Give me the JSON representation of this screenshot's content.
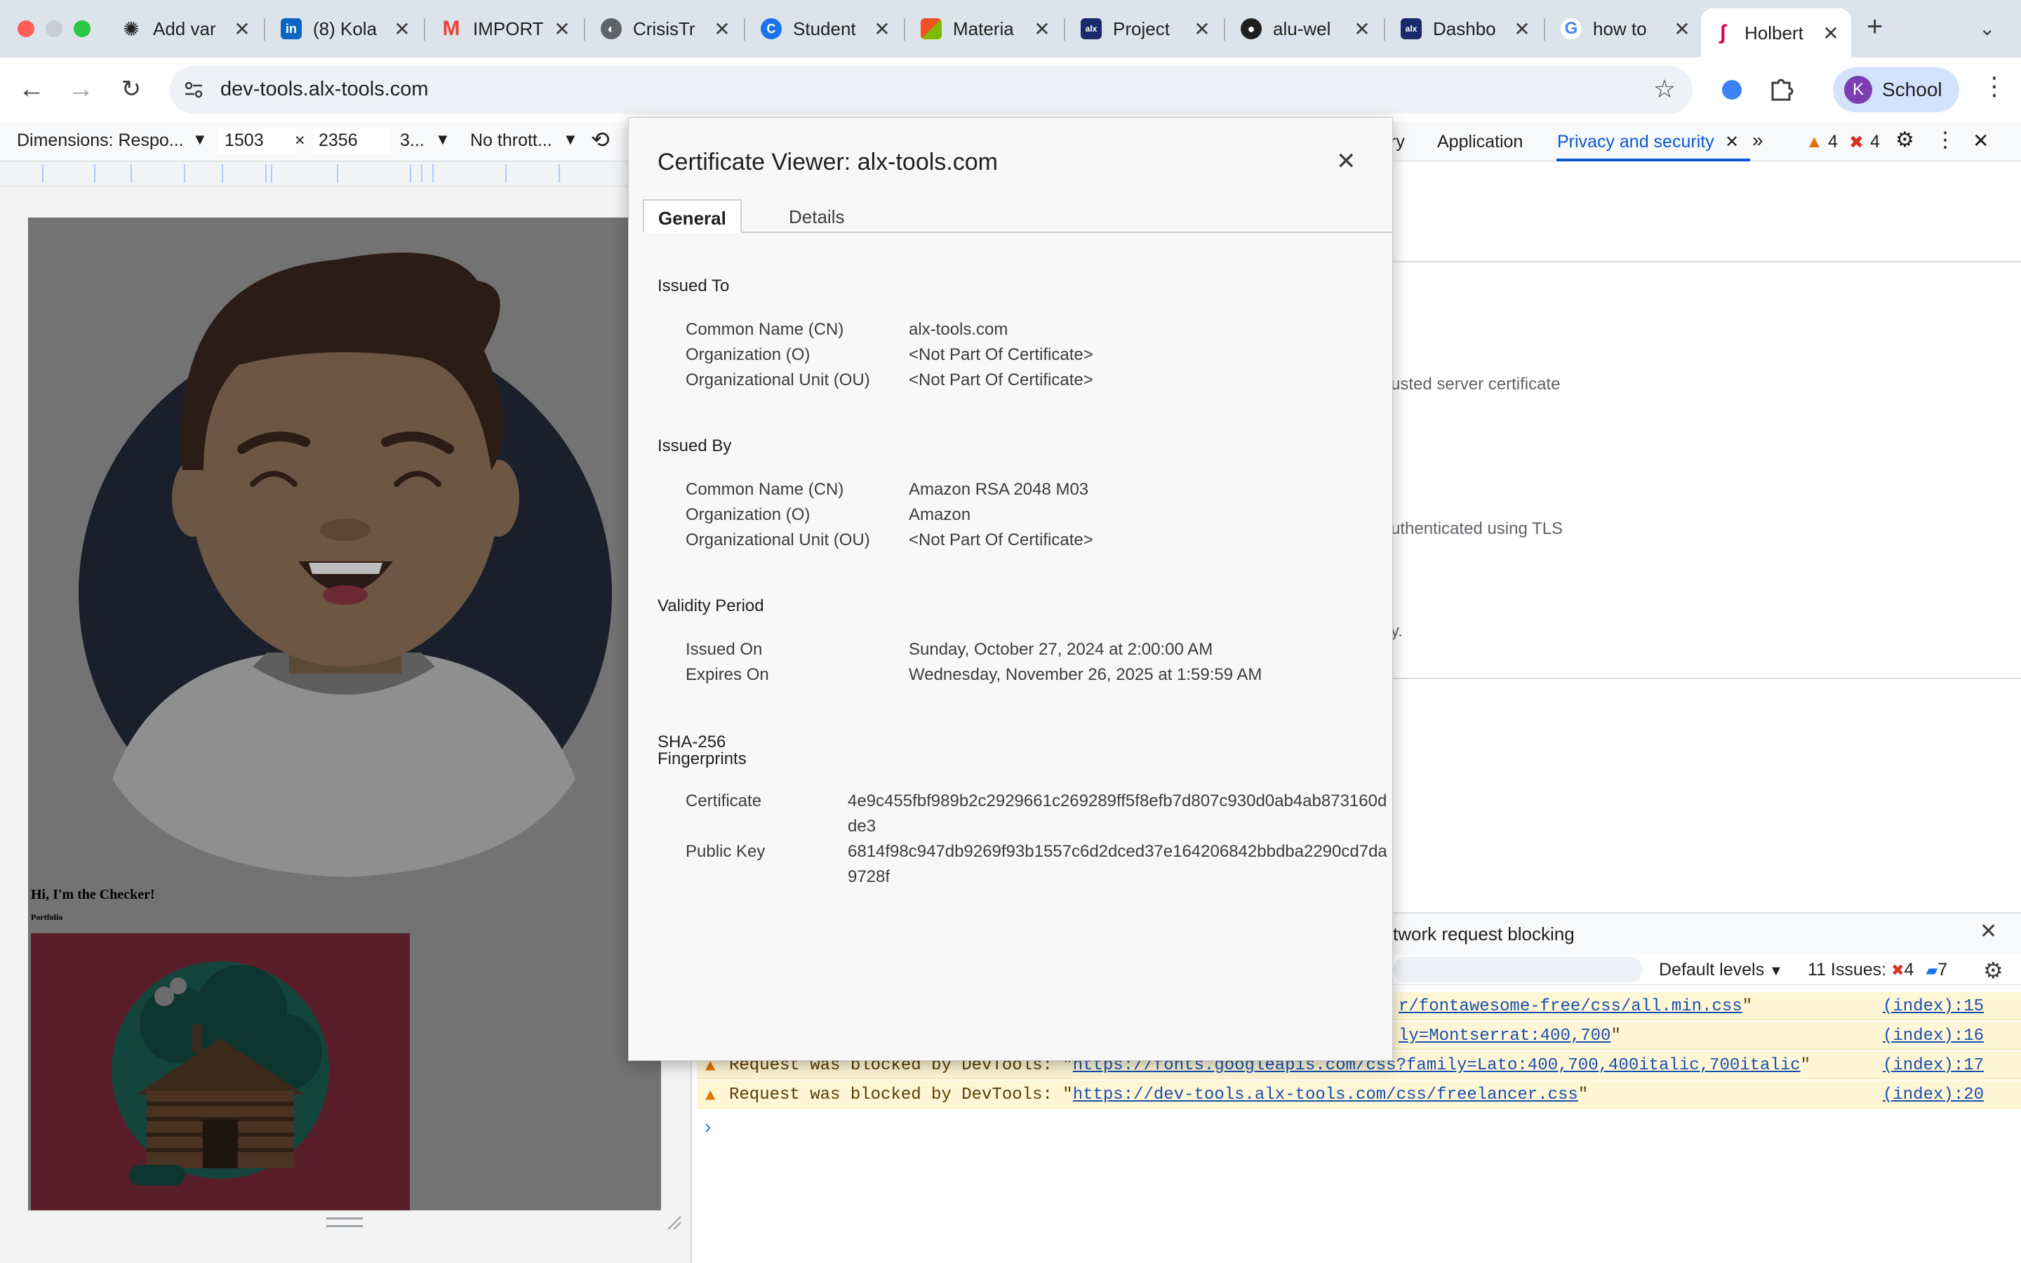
{
  "tabs": [
    {
      "title": "Add var",
      "icon": "openai-icon",
      "color": "#1f1f1f"
    },
    {
      "title": "(8) Kola",
      "icon": "linkedin-icon",
      "color": "#0a66c2"
    },
    {
      "title": "IMPORT",
      "icon": "gmail-icon",
      "color": "#ea4335"
    },
    {
      "title": "CrisisTr",
      "icon": "globe-icon",
      "color": "#5f6368"
    },
    {
      "title": "Student",
      "icon": "c-letter-icon",
      "color": "#1a73e8"
    },
    {
      "title": "Materia",
      "icon": "microsoft-icon",
      "color": "#f25022"
    },
    {
      "title": "Project",
      "icon": "alx-icon",
      "color": "#1b2a6b"
    },
    {
      "title": "alu-wel",
      "icon": "github-icon",
      "color": "#1f1f1f"
    },
    {
      "title": "Dashbo",
      "icon": "alx-icon",
      "color": "#1b2a6b"
    },
    {
      "title": "how to",
      "icon": "google-icon",
      "color": "#4285f4"
    },
    {
      "title": "Holbert",
      "icon": "holberton-icon",
      "color": "#e0004d"
    }
  ],
  "address": {
    "url": "dev-tools.alx-tools.com"
  },
  "profile": {
    "initial": "K",
    "name": "School"
  },
  "device_toolbar": {
    "dimensions": "Dimensions: Respo...",
    "width": "1503",
    "times": "×",
    "height": "2356",
    "dpr": "3...",
    "throttle": "No thrott..."
  },
  "devtools": {
    "tabs": [
      "ry",
      "Application",
      "Privacy and security"
    ],
    "warning_count": "4",
    "error_count": "4",
    "security_lines": [
      "usted server certificate",
      "uthenticated using TLS",
      "y."
    ],
    "drawer_title": "twork request blocking",
    "default_levels": "Default levels",
    "issues_label": "11 Issues:",
    "issues_errors": "4",
    "issues_info": "7",
    "console_rows": [
      {
        "prefix": "",
        "link": "r/fontawesome-free/css/all.min.css",
        "suffix": "\"",
        "ref": "(index):15"
      },
      {
        "prefix": "",
        "link": "ly=Montserrat:400,700",
        "suffix": "\"",
        "ref": "(index):16"
      },
      {
        "prefix": "Request was blocked by DevTools: \"",
        "link": "https://fonts.googleapis.com/css?family=Lato:400,700,400italic,700italic",
        "suffix": "\"",
        "ref": "(index):17"
      },
      {
        "prefix": "Request was blocked by DevTools: \"",
        "link": "https://dev-tools.alx-tools.com/css/freelancer.css",
        "suffix": "\"",
        "ref": "(index):20"
      }
    ],
    "prompt": "›"
  },
  "page": {
    "greeting": "Hi, I'm the Checker!",
    "portfolio": "Portfolio"
  },
  "certificate": {
    "title": "Certificate Viewer: alx-tools.com",
    "tab_general": "General",
    "tab_details": "Details",
    "issued_to": {
      "heading": "Issued To",
      "cn_label": "Common Name (CN)",
      "cn": "alx-tools.com",
      "o_label": "Organization (O)",
      "o": "<Not Part Of Certificate>",
      "ou_label": "Organizational Unit (OU)",
      "ou": "<Not Part Of Certificate>"
    },
    "issued_by": {
      "heading": "Issued By",
      "cn_label": "Common Name (CN)",
      "cn": "Amazon RSA 2048 M03",
      "o_label": "Organization (O)",
      "o": "Amazon",
      "ou_label": "Organizational Unit (OU)",
      "ou": "<Not Part Of Certificate>"
    },
    "validity": {
      "heading": "Validity Period",
      "issued_label": "Issued On",
      "issued": "Sunday, October 27, 2024 at 2:00:00 AM",
      "expires_label": "Expires On",
      "expires": "Wednesday, November 26, 2025 at 1:59:59 AM"
    },
    "fingerprints": {
      "heading1": "SHA-256",
      "heading2": "Fingerprints",
      "cert_label": "Certificate",
      "cert": "4e9c455fbf989b2c2929661c269289ff5f8efb7d807c930d0ab4ab873160dde3",
      "key_label": "Public Key",
      "key": "6814f98c947db9269f93b1557c6d2dced37e164206842bbdba2290cd7da9728f"
    }
  },
  "colors": {
    "accent": "#0b57d0",
    "warning": "#e37400",
    "error": "#d93025"
  }
}
